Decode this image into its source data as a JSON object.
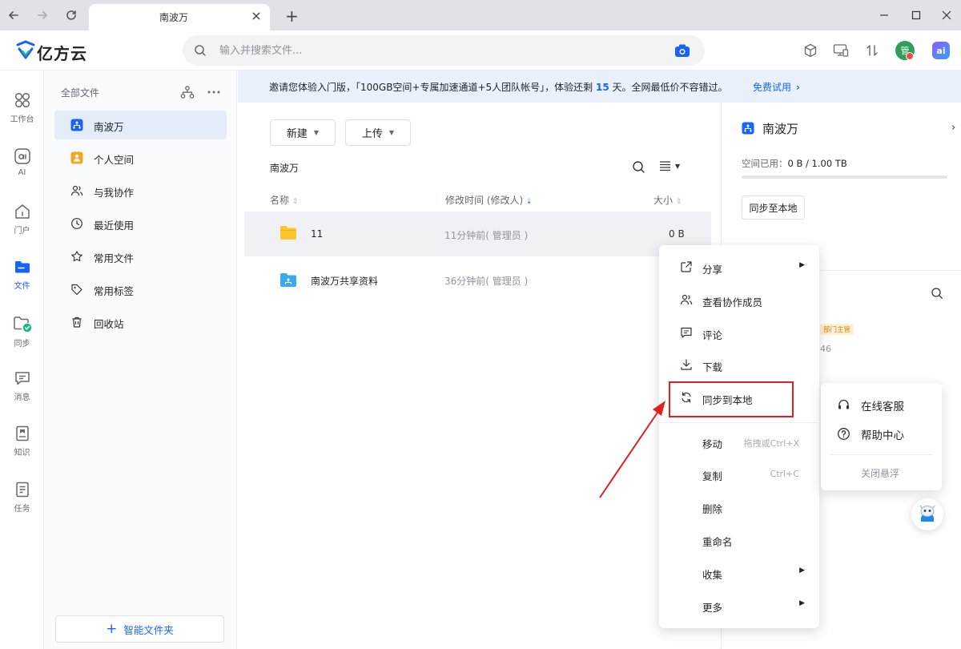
{
  "browser": {
    "tab_title": "南波万",
    "new_tab_symbol": "+"
  },
  "header": {
    "logo_text": "亿方云",
    "search_placeholder": "输入并搜索文件...",
    "avatar_text": "管",
    "ai_badge": "ai"
  },
  "rail": {
    "items": [
      {
        "label": "工作台",
        "icon": "grid-icon"
      },
      {
        "label": "AI",
        "icon": "ai-icon"
      },
      {
        "label": "门户",
        "icon": "home-icon"
      },
      {
        "label": "文件",
        "icon": "folder-icon",
        "active": true
      },
      {
        "label": "同步",
        "icon": "sync-folder-icon"
      },
      {
        "label": "消息",
        "icon": "message-icon"
      },
      {
        "label": "知识",
        "icon": "knowledge-icon"
      },
      {
        "label": "任务",
        "icon": "task-icon"
      }
    ]
  },
  "sidebar": {
    "title": "全部文件",
    "items": [
      {
        "label": "南波万",
        "icon": "team-folder-icon",
        "active": true
      },
      {
        "label": "个人空间",
        "icon": "personal-icon"
      },
      {
        "label": "与我协作",
        "icon": "collab-icon"
      },
      {
        "label": "最近使用",
        "icon": "clock-icon"
      },
      {
        "label": "常用文件",
        "icon": "star-icon"
      },
      {
        "label": "常用标签",
        "icon": "tag-icon"
      },
      {
        "label": "回收站",
        "icon": "trash-icon"
      }
    ],
    "smart_folder": "智能文件夹"
  },
  "banner": {
    "text_before": "邀请您体验入门版，「100GB空间+专属加速通道+5人团队帐号」，体验还剩 ",
    "days": "15",
    "text_after": " 天。全网最低价不容错过。",
    "link": "免费试用"
  },
  "toolbar": {
    "new_label": "新建",
    "upload_label": "上传"
  },
  "breadcrumb": "南波万",
  "table": {
    "col_name": "名称",
    "col_modified": "修改时间 (修改人)",
    "col_size": "大小",
    "rows": [
      {
        "name": "11",
        "modified": "11分钟前( 管理员 )",
        "size": "0 B",
        "icon": "folder-yellow-icon"
      },
      {
        "name": "南波万共享资料",
        "modified": "36分钟前( 管理员 )",
        "size": "",
        "icon": "shared-folder-icon"
      }
    ]
  },
  "detail": {
    "title": "南波万",
    "space_label": "空间已用：",
    "space_value": "0 B / 1.00 TB",
    "space_used_fraction": 0,
    "sync_button": "同步至本地",
    "member_badge": "部门主管",
    "member_partial": "46"
  },
  "context_menu": {
    "items": [
      {
        "label": "分享",
        "icon": "share-icon",
        "arrow": true
      },
      {
        "label": "查看协作成员",
        "icon": "members-icon"
      },
      {
        "label": "评论",
        "icon": "comment-icon"
      },
      {
        "label": "下载",
        "icon": "download-icon"
      },
      {
        "label": "同步到本地",
        "icon": "sync-icon",
        "highlighted": true
      },
      {
        "label": "移动",
        "shortcut": "拖拽或Ctrl+X"
      },
      {
        "label": "复制",
        "shortcut": "Ctrl+C"
      },
      {
        "label": "删除"
      },
      {
        "label": "重命名"
      },
      {
        "label": "收集",
        "arrow": true
      },
      {
        "label": "更多",
        "arrow": true
      }
    ]
  },
  "help_popup": {
    "online_service": "在线客服",
    "help_center": "帮助中心",
    "close_float": "关闭悬浮"
  },
  "colors": {
    "accent": "#1664ff",
    "highlight_box": "#e02020",
    "annotation_arrow": "#e02020"
  }
}
